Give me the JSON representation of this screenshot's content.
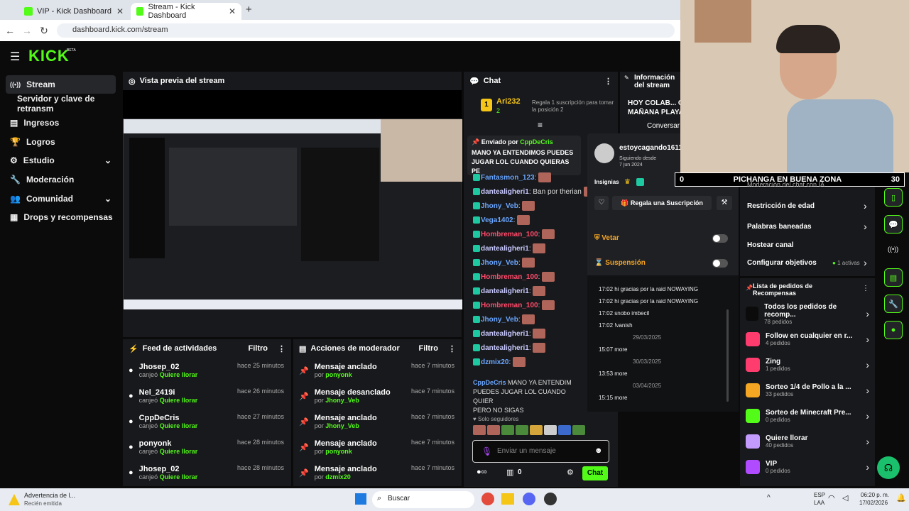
{
  "browser": {
    "tabs": [
      {
        "title": "VIP - Kick Dashboard"
      },
      {
        "title": "Stream - Kick Dashboard"
      }
    ],
    "url": "dashboard.kick.com/stream"
  },
  "brand": {
    "logo": "KICK",
    "beta": "BETA"
  },
  "sidebar": {
    "items": [
      {
        "label": "Stream",
        "icon": "broadcast-icon"
      },
      {
        "label": "Servidor y clave de retransm"
      },
      {
        "label": "Ingresos",
        "icon": "chart-icon"
      },
      {
        "label": "Logros",
        "icon": "trophy-icon"
      },
      {
        "label": "Estudio",
        "icon": "studio-icon"
      },
      {
        "label": "Moderación",
        "icon": "wrench-icon"
      },
      {
        "label": "Comunidad",
        "icon": "community-icon"
      },
      {
        "label": "Drops y recompensas",
        "icon": "drops-icon"
      }
    ]
  },
  "preview": {
    "title": "Vista previa del stream"
  },
  "feed": {
    "title": "Feed de actividades",
    "filter": "Filtro",
    "rows": [
      {
        "name": "Jhosep_02",
        "sub": "canjeó ",
        "reward": "Quiere llorar",
        "time": "hace 25 minutos"
      },
      {
        "name": "Nel_2419i",
        "sub": "canjeó ",
        "reward": "Quiere llorar",
        "time": "hace 26 minutos"
      },
      {
        "name": "CppDeCris",
        "sub": "canjeó ",
        "reward": "Quiere llorar",
        "time": "hace 27 minutos"
      },
      {
        "name": "ponyonk",
        "sub": "canjeó ",
        "reward": "Quiere llorar",
        "time": "hace 28 minutos"
      },
      {
        "name": "Jhosep_02",
        "sub": "canjeó ",
        "reward": "Quiere llorar",
        "time": "hace 28 minutos"
      }
    ]
  },
  "modactions": {
    "title": "Acciones de moderador",
    "filter": "Filtro",
    "rows": [
      {
        "name": "Mensaje anclado",
        "sub": "por ",
        "user": "ponyonk",
        "time": "hace 7 minutos"
      },
      {
        "name": "Mensaje desanclado",
        "sub": "por ",
        "user": "Jhony_Veb",
        "time": "hace 7 minutos"
      },
      {
        "name": "Mensaje anclado",
        "sub": "por ",
        "user": "Jhony_Veb",
        "time": "hace 7 minutos"
      },
      {
        "name": "Mensaje anclado",
        "sub": "por ",
        "user": "ponyonk",
        "time": "hace 7 minutos"
      },
      {
        "name": "Mensaje anclado",
        "sub": "por ",
        "user": "dzmix20",
        "time": "hace 7 minutos"
      }
    ]
  },
  "chat": {
    "title": "Chat",
    "top_user": "Ari232",
    "top_level": "2",
    "gift_text": "Regala 1 suscripción para tomar la posición 2",
    "pinned_by": "Enviado por",
    "pinned_user": "CppDeCris",
    "pinned_text": "MANO YA ENTENDIMOS PUEDES JUGAR LOL CUANDO QUIERAS PE",
    "lines": [
      {
        "user": "Fantasmon_123",
        "color": "#6aa6ff",
        "text": ""
      },
      {
        "user": "dantealigheri1",
        "color": "#c9c9ff",
        "text": " Ban por therian"
      },
      {
        "user": "Jhony_Veb",
        "color": "#6aa6ff",
        "text": ""
      },
      {
        "user": "Vega1402",
        "color": "#6aa6ff",
        "text": ""
      },
      {
        "user": "Hombreman_100",
        "color": "#ff4a6a",
        "text": ""
      },
      {
        "user": "dantealigheri1",
        "color": "#c9c9ff",
        "text": ""
      },
      {
        "user": "Jhony_Veb",
        "color": "#6aa6ff",
        "text": ""
      },
      {
        "user": "Hombreman_100",
        "color": "#ff4a6a",
        "text": ""
      },
      {
        "user": "dantealigheri1",
        "color": "#c9c9ff",
        "text": ""
      },
      {
        "user": "Hombreman_100",
        "color": "#ff4a6a",
        "text": ""
      },
      {
        "user": "Jhony_Veb",
        "color": "#6aa6ff",
        "text": ""
      },
      {
        "user": "dantealigheri1",
        "color": "#c9c9ff",
        "text": ""
      },
      {
        "user": "dantealigheri1",
        "color": "#c9c9ff",
        "text": ""
      },
      {
        "user": "dzmix20",
        "color": "#6aa6ff",
        "text": ""
      }
    ],
    "last_user": "CppDeCris",
    "last_text": " MANO YA ENTENDIM",
    "last_text2": "PUEDES JUGAR LOL CUANDO QUIER",
    "last_text3": "PERO NO SIGAS",
    "followers_only": "Solo seguidores",
    "input_placeholder": "Enviar un mensaje",
    "count": "0",
    "send": "Chat"
  },
  "usercard": {
    "name": "estoycagando1611",
    "following_label": "Siguiendo desde",
    "following_date": "7 jun 2024",
    "badges_label": "Insignias",
    "gift_btn": "Regala una Suscripción",
    "ban": "Vetar",
    "timeout": "Suspensión",
    "messages": [
      "17:02 hi gracias por la raid NOWAYING",
      "17:02 hi gracias por la raid NOWAYING",
      "17:02 snobo imbecil",
      "17:02 !vanish"
    ],
    "dates": [
      {
        "date": "29/03/2025",
        "msg": "15:07 more"
      },
      {
        "date": "30/03/2025",
        "msg": "13:53 more"
      },
      {
        "date": "03/04/2025",
        "msg": "15:15 more"
      }
    ]
  },
  "info": {
    "title": "Información del stream",
    "stream_title": "HOY COLAB... O MAÑANA PLAYA",
    "convers": "Conversar"
  },
  "overlay": {
    "left": "0",
    "title": "PICHANGA EN BUENA ZONA",
    "right": "30"
  },
  "settings": {
    "items": [
      {
        "label": "Moderación del chat con IA"
      },
      {
        "label": "Restricción de edad"
      },
      {
        "label": "Palabras baneadas"
      },
      {
        "label": "Hostear canal"
      },
      {
        "label": "Configurar objetivos",
        "extra": "1 activas"
      }
    ]
  },
  "rewards": {
    "title": "Lista de pedidos de Recompensas",
    "items": [
      {
        "title": "Todos los pedidos de recomp...",
        "sub": "78 pedidos",
        "color": "#0b0b0c"
      },
      {
        "title": "Follow en cualquier en r...",
        "sub": "4 pedidos",
        "color": "#ff3c6e"
      },
      {
        "title": "Zing",
        "sub": "1 pedidos",
        "color": "#ff3c6e"
      },
      {
        "title": "Sorteo 1/4 de Pollo a la ...",
        "sub": "33 pedidos",
        "color": "#f5a623"
      },
      {
        "title": "Sorteo de Minecraft Pre...",
        "sub": "0 pedidos",
        "color": "#53fc18"
      },
      {
        "title": "Quiere llorar",
        "sub": "40 pedidos",
        "color": "#c39bff"
      },
      {
        "title": "VIP",
        "sub": "0 pedidos",
        "color": "#b04bff"
      }
    ]
  },
  "taskbar": {
    "notif_title": "Advertencia de l...",
    "notif_sub": "Recién emitida",
    "search": "Buscar",
    "lang1": "ESP",
    "lang2": "LAA",
    "time": "06:20 p. m.",
    "date": "17/02/2026"
  }
}
